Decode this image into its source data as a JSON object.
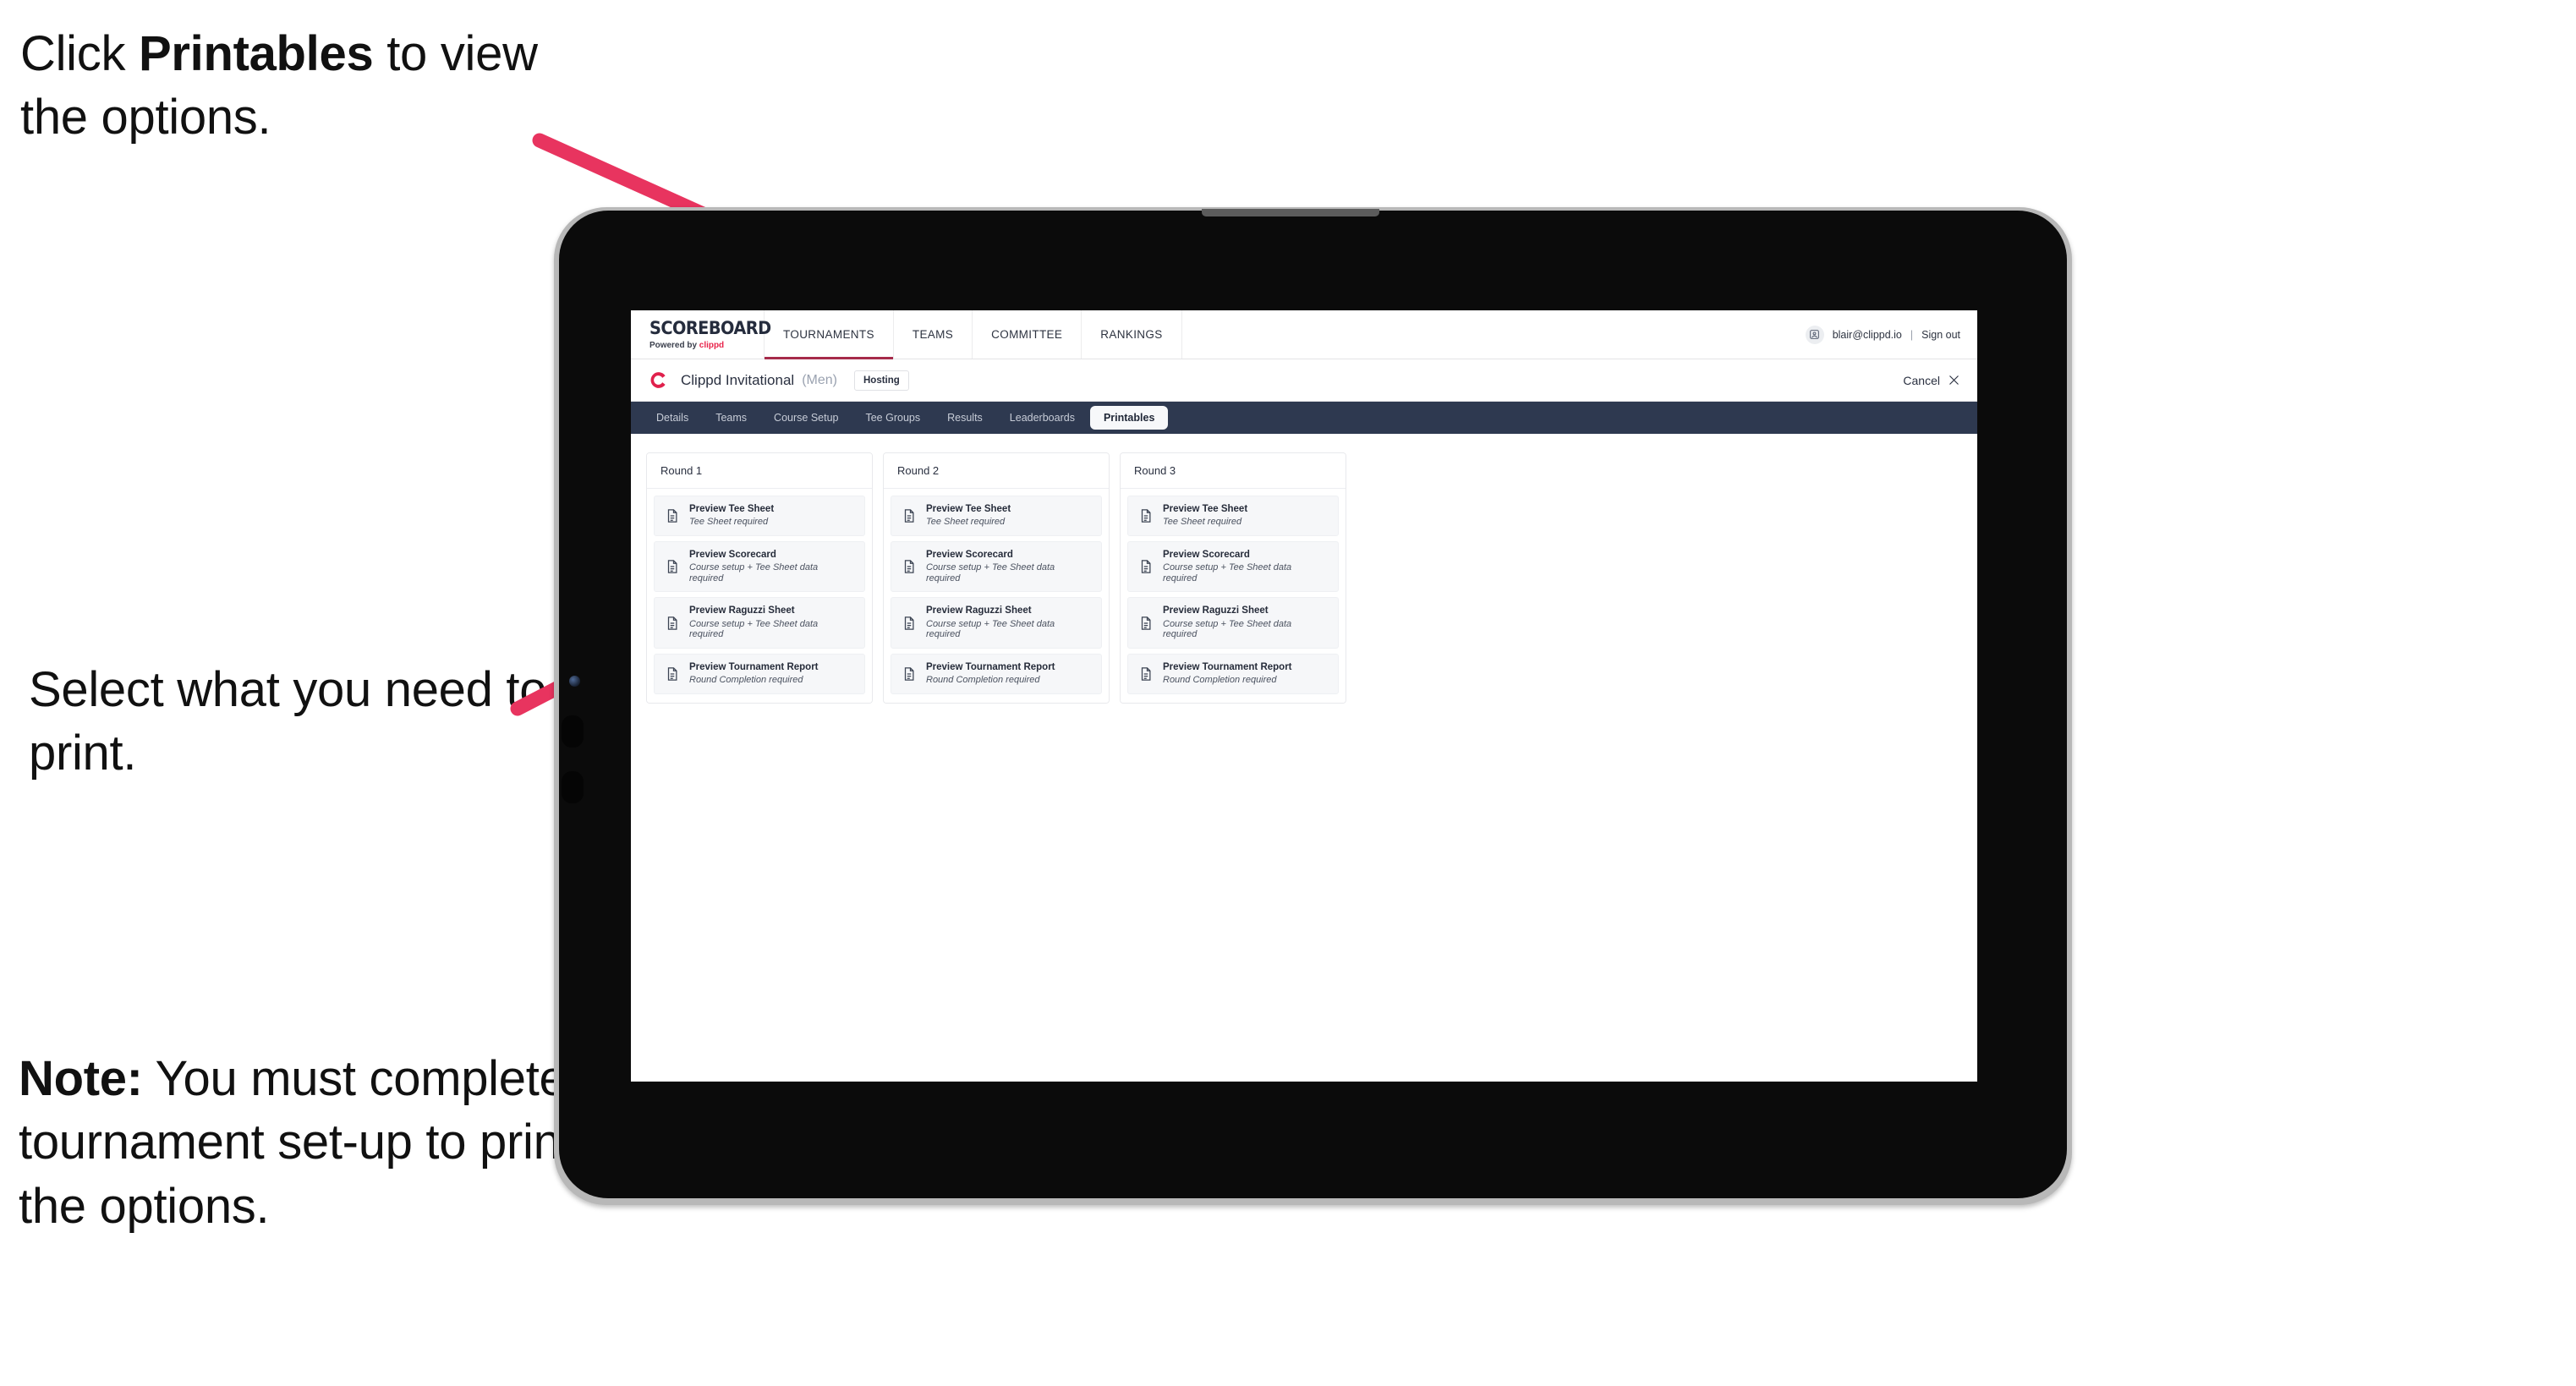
{
  "annotations": {
    "top": {
      "pre": "Click ",
      "bold": "Printables",
      "post": " to view the options."
    },
    "middle": {
      "text": "Select what you need to print."
    },
    "note": {
      "bold": "Note:",
      "text": " You must complete the tournament set-up to print all the options."
    }
  },
  "colors": {
    "arrow_pink": "#e8345f",
    "brand_pink": "#e8234a",
    "tabstrip_dark": "#2e3950",
    "nav_active_underline": "#a62b4a"
  },
  "app": {
    "brand": {
      "wordmark": "SCOREBOARD",
      "powered_prefix": "Powered by ",
      "powered_brand": "clippd"
    },
    "main_nav": [
      {
        "label": "TOURNAMENTS",
        "active": true
      },
      {
        "label": "TEAMS",
        "active": false
      },
      {
        "label": "COMMITTEE",
        "active": false
      },
      {
        "label": "RANKINGS",
        "active": false
      }
    ],
    "user": {
      "email": "blair@clippd.io",
      "separator": "|",
      "sign_out": "Sign out",
      "avatar_icon": "user-avatar-icon"
    },
    "tournament": {
      "logo_icon": "clippd-c-logo-icon",
      "name": "Clippd Invitational",
      "gender": "(Men)",
      "badge": "Hosting",
      "cancel_label": "Cancel",
      "cancel_icon": "close-x-icon"
    },
    "tabs": [
      {
        "label": "Details",
        "active": false
      },
      {
        "label": "Teams",
        "active": false
      },
      {
        "label": "Course Setup",
        "active": false
      },
      {
        "label": "Tee Groups",
        "active": false
      },
      {
        "label": "Results",
        "active": false
      },
      {
        "label": "Leaderboards",
        "active": false
      },
      {
        "label": "Printables",
        "active": true
      }
    ],
    "printables": {
      "rounds": [
        {
          "title": "Round 1",
          "items": [
            {
              "title": "Preview Tee Sheet",
              "subtitle": "Tee Sheet required",
              "icon": "document-icon"
            },
            {
              "title": "Preview Scorecard",
              "subtitle": "Course setup + Tee Sheet data required",
              "icon": "document-icon"
            },
            {
              "title": "Preview Raguzzi Sheet",
              "subtitle": "Course setup + Tee Sheet data required",
              "icon": "document-icon"
            },
            {
              "title": "Preview Tournament Report",
              "subtitle": "Round Completion required",
              "icon": "document-icon"
            }
          ]
        },
        {
          "title": "Round 2",
          "items": [
            {
              "title": "Preview Tee Sheet",
              "subtitle": "Tee Sheet required",
              "icon": "document-icon"
            },
            {
              "title": "Preview Scorecard",
              "subtitle": "Course setup + Tee Sheet data required",
              "icon": "document-icon"
            },
            {
              "title": "Preview Raguzzi Sheet",
              "subtitle": "Course setup + Tee Sheet data required",
              "icon": "document-icon"
            },
            {
              "title": "Preview Tournament Report",
              "subtitle": "Round Completion required",
              "icon": "document-icon"
            }
          ]
        },
        {
          "title": "Round 3",
          "items": [
            {
              "title": "Preview Tee Sheet",
              "subtitle": "Tee Sheet required",
              "icon": "document-icon"
            },
            {
              "title": "Preview Scorecard",
              "subtitle": "Course setup + Tee Sheet data required",
              "icon": "document-icon"
            },
            {
              "title": "Preview Raguzzi Sheet",
              "subtitle": "Course setup + Tee Sheet data required",
              "icon": "document-icon"
            },
            {
              "title": "Preview Tournament Report",
              "subtitle": "Round Completion required",
              "icon": "document-icon"
            }
          ]
        }
      ]
    }
  }
}
